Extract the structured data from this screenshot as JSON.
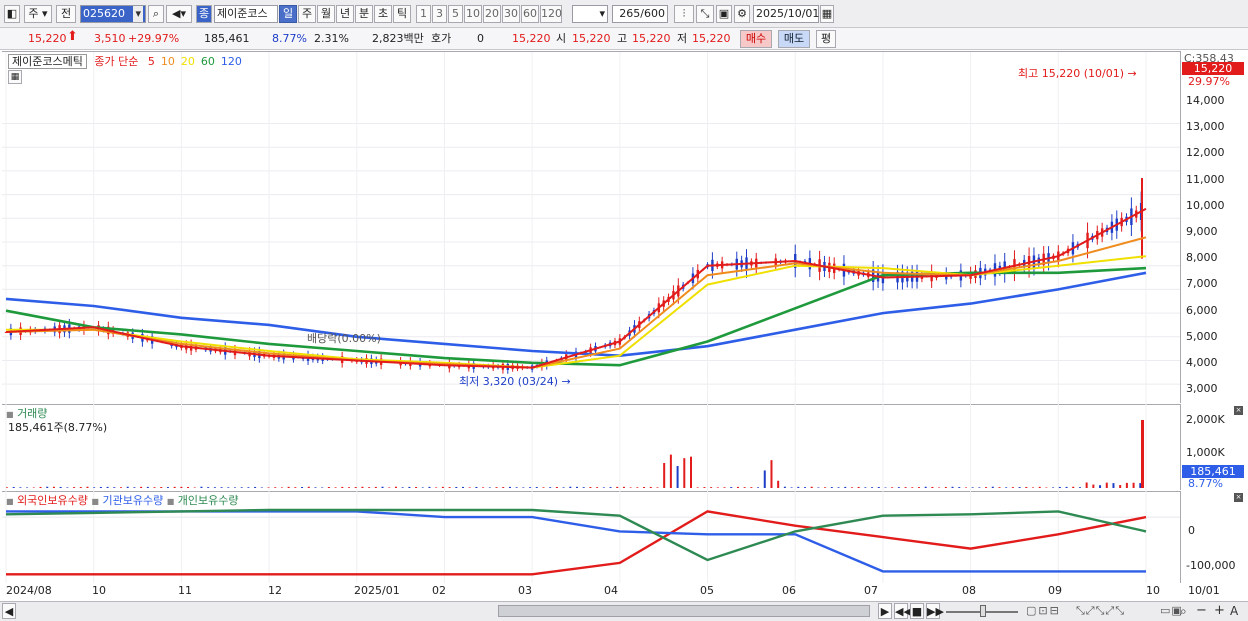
{
  "toolbar": {
    "market_label": "주",
    "prev_label": "전",
    "code": "025620",
    "badge_label": "종",
    "stock_name": "제이준코스",
    "periods": [
      "일",
      "주",
      "월",
      "년",
      "분",
      "초",
      "틱"
    ],
    "active_period": "일",
    "minute_units": [
      "1",
      "3",
      "5",
      "10",
      "20",
      "30",
      "60",
      "120"
    ],
    "count_value": "265",
    "count_max": "/600",
    "date_value": "2025/10/01"
  },
  "quote": {
    "price": "15,220",
    "change": "3,510",
    "change_rate": "+29.97%",
    "volume": "185,461",
    "vol_ratio": "8.77%",
    "turnover": "2.31%",
    "amount": "2,823백만",
    "hoga_label": "호가",
    "hoga_value": "0",
    "hoga_price": "15,220",
    "open_label": "시",
    "open": "15,220",
    "high_label": "고",
    "high": "15,220",
    "low_label": "저",
    "low": "15,220",
    "buy_label": "매수",
    "sell_label": "매도",
    "avg_label": "평"
  },
  "price_pane": {
    "legend_name": "제이준코스메틱",
    "ma_label": "종가 단순",
    "ma_periods": [
      "5",
      "10",
      "20",
      "60",
      "120"
    ],
    "ma_colors": [
      "#e21b1b",
      "#f08c1e",
      "#f0e000",
      "#1e9a3c",
      "#2e5ee8"
    ],
    "high_marker": "최고 15,220 (10/01)",
    "low_marker": "최저 3,320 (03/24)",
    "event_marker": "배당락(0.00%)",
    "top_label": "C:358.43",
    "price_tag": "15,220",
    "rate_tag": "29.97%",
    "y_ticks": [
      "14,000",
      "13,000",
      "12,000",
      "11,000",
      "10,000",
      "9,000",
      "8,000",
      "7,000",
      "6,000",
      "5,000",
      "4,000",
      "3,000"
    ]
  },
  "volume_pane": {
    "title": "거래량",
    "subtitle": "185,461주(8.77%)",
    "y_ticks": [
      "2,000K",
      "1,000K"
    ],
    "vol_tag": "185,461",
    "rate_tag": "8.77%"
  },
  "holder_pane": {
    "legends": [
      "외국인보유수량",
      "기관보유수량",
      "개인보유수량"
    ],
    "colors": [
      "#e21b1b",
      "#2e5ee8",
      "#2e8a52"
    ],
    "y_ticks": [
      "0",
      "-100,000"
    ]
  },
  "x_axis": {
    "labels": [
      "2024/08",
      "10",
      "11",
      "12",
      "2025/01",
      "02",
      "03",
      "04",
      "05",
      "06",
      "07",
      "08",
      "09",
      "10"
    ],
    "right_label": "10/01"
  },
  "chart_data": {
    "type": "line",
    "title": "",
    "ylim": [
      2500,
      15500
    ],
    "x": [
      "2024/08",
      "10",
      "11",
      "12",
      "2025/01",
      "02",
      "03",
      "04",
      "05",
      "06",
      "07",
      "08",
      "09",
      "10"
    ],
    "series": [
      {
        "name": "5",
        "values": [
          5200,
          5400,
          4600,
          4200,
          4000,
          3800,
          3700,
          4800,
          8000,
          8200,
          7500,
          7600,
          8400,
          10400
        ]
      },
      {
        "name": "10",
        "values": [
          5200,
          5300,
          4700,
          4300,
          4000,
          3850,
          3700,
          4500,
          7600,
          8100,
          7700,
          7600,
          8200,
          9200
        ]
      },
      {
        "name": "20",
        "values": [
          5300,
          5300,
          4800,
          4400,
          4050,
          3900,
          3700,
          4200,
          7200,
          8000,
          7900,
          7600,
          8000,
          8400
        ]
      },
      {
        "name": "60",
        "values": [
          6100,
          5400,
          5100,
          4700,
          4400,
          4100,
          3900,
          3800,
          4800,
          6200,
          7600,
          7700,
          7700,
          7900
        ]
      },
      {
        "name": "120",
        "values": [
          6600,
          6300,
          5800,
          5500,
          5000,
          4700,
          4400,
          4200,
          4600,
          5300,
          6000,
          6400,
          7000,
          7700
        ]
      }
    ],
    "volume_peak": 2100000,
    "holders": [
      {
        "name": "외국인보유수량",
        "values": [
          -200000,
          -200000,
          -200000,
          -200000,
          -200000,
          -200000,
          -200000,
          -160000,
          20000,
          -30000,
          -70000,
          -110000,
          -60000,
          0
        ]
      },
      {
        "name": "기관보유수량",
        "values": [
          20000,
          20000,
          20000,
          20000,
          20000,
          0,
          0,
          -50000,
          -60000,
          -60000,
          -190000,
          -190000,
          -190000,
          -190000
        ]
      },
      {
        "name": "개인보유수량",
        "values": [
          10000,
          15000,
          20000,
          25000,
          25000,
          25000,
          25000,
          5000,
          -150000,
          -50000,
          5000,
          10000,
          20000,
          -50000
        ]
      }
    ]
  }
}
